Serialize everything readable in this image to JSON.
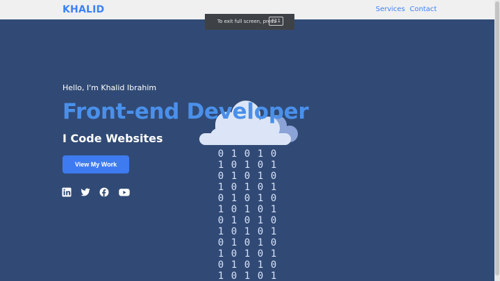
{
  "nav": {
    "brand": "KHALID",
    "links": [
      "Services",
      "Contact"
    ]
  },
  "fullscreen_notice": {
    "text": "To exit full screen, press",
    "key": "F11"
  },
  "hero": {
    "greeting": "Hello, I'm Khalid Ibrahim",
    "headline": "Front-end Developer",
    "subheadline": "I Code Websites",
    "cta_label": "View My Work"
  },
  "socials": [
    "linkedin-icon",
    "twitter-icon",
    "facebook-icon",
    "youtube-icon"
  ],
  "binary_rows": [
    "01010",
    "10101",
    "01010",
    "10101",
    "01010",
    "10101",
    "01010",
    "10101",
    "01010",
    "10101",
    "01010",
    "10101"
  ],
  "colors": {
    "background": "#314a75",
    "accent": "#4a90ea",
    "button": "#3e7bf0",
    "navbar": "#f0f0f1",
    "cloud": "#dbe5f7"
  }
}
